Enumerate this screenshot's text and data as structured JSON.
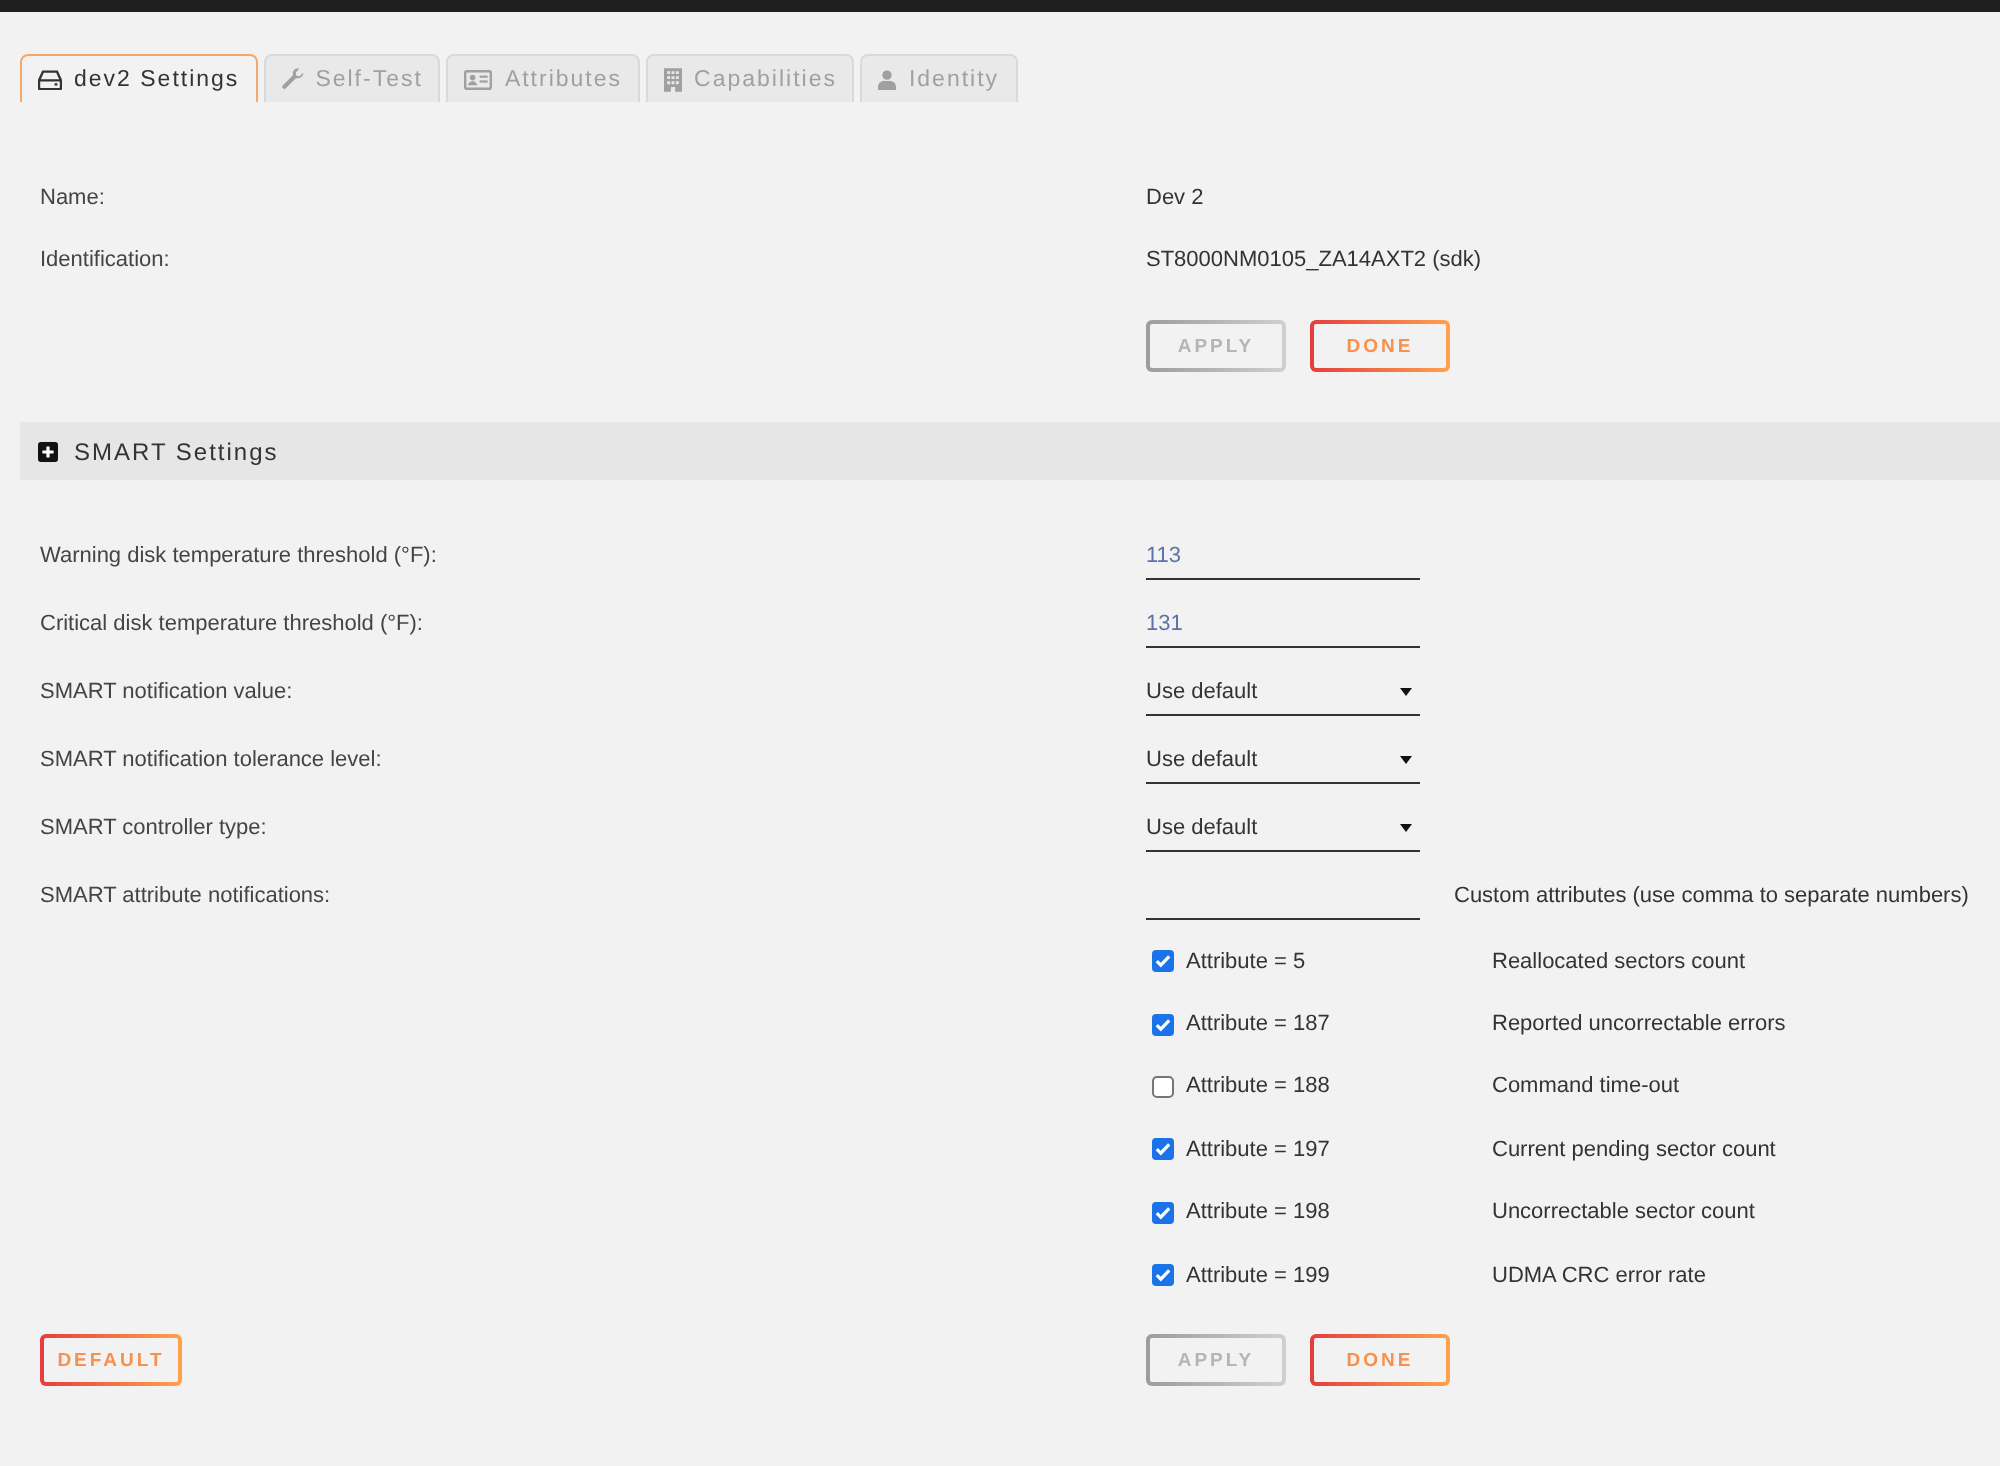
{
  "tabs": [
    {
      "label": "dev2 Settings",
      "selected": true
    },
    {
      "label": "Self-Test",
      "selected": false
    },
    {
      "label": "Attributes",
      "selected": false
    },
    {
      "label": "Capabilities",
      "selected": false
    },
    {
      "label": "Identity",
      "selected": false
    }
  ],
  "general": {
    "fields": [
      {
        "label": "Name:",
        "value": "Dev 2"
      },
      {
        "label": "Identification:",
        "value": "ST8000NM0105_ZA14AXT2 (sdk)"
      }
    ],
    "buttons": [
      {
        "label": "APPLY",
        "disabled": true
      },
      {
        "label": "DONE",
        "disabled": false
      }
    ]
  },
  "smart": {
    "title": "SMART Settings",
    "fields": [
      {
        "kind": "input",
        "label": "Warning disk temperature threshold (°F):",
        "value": "113"
      },
      {
        "kind": "input",
        "label": "Critical disk temperature threshold (°F):",
        "value": "131"
      },
      {
        "kind": "select",
        "label": "SMART notification value:",
        "value": "Use default"
      },
      {
        "kind": "select",
        "label": "SMART notification tolerance level:",
        "value": "Use default"
      },
      {
        "kind": "select",
        "label": "SMART controller type:",
        "value": "Use default"
      },
      {
        "kind": "input",
        "label": "SMART attribute notifications:",
        "note": "Custom attributes (use comma to separate numbers)"
      }
    ],
    "attributes": [
      {
        "label": "Attribute = 5",
        "description": "Reallocated sectors count",
        "checked": true
      },
      {
        "label": "Attribute = 187",
        "description": "Reported uncorrectable errors",
        "checked": true
      },
      {
        "label": "Attribute = 188",
        "description": "Command time-out",
        "checked": false
      },
      {
        "label": "Attribute = 197",
        "description": "Current pending sector count",
        "checked": true
      },
      {
        "label": "Attribute = 198",
        "description": "Uncorrectable sector count",
        "checked": true
      },
      {
        "label": "Attribute = 199",
        "description": "UDMA CRC error rate",
        "checked": true
      }
    ]
  },
  "footer": {
    "default_button": {
      "label": "DEFAULT",
      "disabled": false
    },
    "buttons": [
      {
        "label": "APPLY",
        "disabled": true
      },
      {
        "label": "DONE",
        "disabled": false
      }
    ]
  }
}
